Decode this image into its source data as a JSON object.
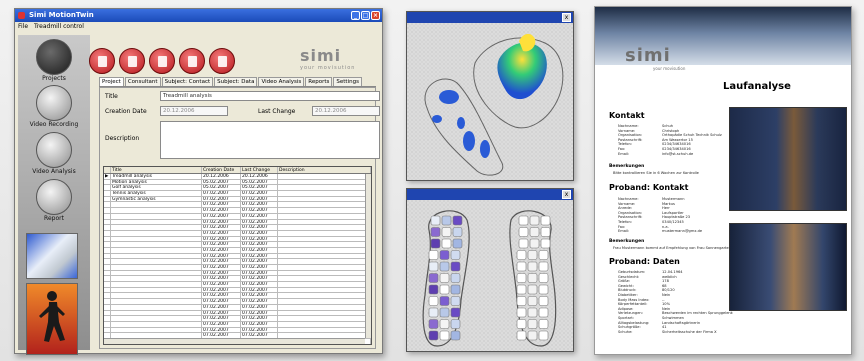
{
  "app": {
    "title": "Simi MotionTwin",
    "menu": [
      "File",
      "Treadmill control"
    ],
    "logo": {
      "text": "simi",
      "tagline": "your movisution"
    }
  },
  "sidebar": {
    "items": [
      {
        "label": "Projects",
        "icon": "folder-icon"
      },
      {
        "label": "Video Recording",
        "icon": "clapperboard-icon"
      },
      {
        "label": "Video Analysis",
        "icon": "analysis-icon"
      },
      {
        "label": "Report",
        "icon": "checkmark-icon"
      }
    ]
  },
  "toolbar": {
    "buttons": [
      "new-icon",
      "open-icon",
      "add-icon",
      "delete-icon",
      "search-icon"
    ]
  },
  "tabs": [
    "Project",
    "Consultant",
    "Subject: Contact",
    "Subject: Data",
    "Video Analysis",
    "Reports",
    "Settings"
  ],
  "form": {
    "title_label": "Title",
    "title_value": "Treadmill analysis",
    "creation_label": "Creation Date",
    "creation_value": "20.12.2006",
    "change_label": "Last Change",
    "change_value": "20.12.2006",
    "description_label": "Description"
  },
  "table": {
    "columns": [
      "Title",
      "Creation Date",
      "Last Change",
      "Description"
    ],
    "rows": [
      [
        "Treadmill analysis",
        "20.12.2006",
        "20.12.2006"
      ],
      [
        "Motion analysis",
        "05.02.2007",
        "05.02.2007"
      ],
      [
        "Golf analysis",
        "05.02.2007",
        "05.02.2007"
      ],
      [
        "Tennis analysis",
        "07.02.2007",
        "07.02.2007"
      ],
      [
        "Gymnastic analysis",
        "07.02.2007",
        "07.02.2007"
      ],
      [
        "",
        "07.02.2007",
        "07.02.2007"
      ],
      [
        "",
        "07.02.2007",
        "07.02.2007"
      ],
      [
        "",
        "07.02.2007",
        "07.02.2007"
      ],
      [
        "",
        "07.02.2007",
        "07.02.2007"
      ],
      [
        "",
        "07.02.2007",
        "07.02.2007"
      ],
      [
        "",
        "07.02.2007",
        "07.02.2007"
      ],
      [
        "",
        "07.02.2007",
        "07.02.2007"
      ],
      [
        "",
        "07.02.2007",
        "07.02.2007"
      ],
      [
        "",
        "07.02.2007",
        "07.02.2007"
      ],
      [
        "",
        "07.02.2007",
        "07.02.2007"
      ],
      [
        "",
        "07.02.2007",
        "07.02.2007"
      ],
      [
        "",
        "07.02.2007",
        "07.02.2007"
      ],
      [
        "",
        "07.02.2007",
        "07.02.2007"
      ],
      [
        "",
        "07.02.2007",
        "07.02.2007"
      ],
      [
        "",
        "07.02.2007",
        "07.02.2007"
      ],
      [
        "",
        "07.02.2007",
        "07.02.2007"
      ],
      [
        "",
        "07.02.2007",
        "07.02.2007"
      ],
      [
        "",
        "07.02.2007",
        "07.02.2007"
      ],
      [
        "",
        "07.02.2007",
        "07.02.2007"
      ],
      [
        "",
        "07.02.2007",
        "07.02.2007"
      ],
      [
        "",
        "07.02.2007",
        "07.02.2007"
      ],
      [
        "",
        "07.02.2007",
        "07.02.2007"
      ],
      [
        "",
        "07.02.2007",
        "07.02.2007"
      ],
      [
        "",
        "07.02.2007",
        "07.02.2007"
      ],
      [
        "",
        "07.02.2007",
        "07.02.2007"
      ],
      [
        "",
        "07.02.2007",
        "07.02.2007"
      ],
      [
        "",
        "07.02.2007",
        "07.02.2007"
      ],
      [
        "",
        "07.02.2007",
        "07.02.2007"
      ]
    ]
  },
  "pressure_window_3d": {
    "close": "x"
  },
  "pressure_window_2d": {
    "close": "x"
  },
  "report": {
    "logo": "simi",
    "tagline": "your movisution",
    "title": "Laufanalyse",
    "sec1": "Kontakt",
    "contact": [
      [
        "Nachname:",
        "Schuh"
      ],
      [
        "Vorname:",
        "Christoph"
      ],
      [
        "Organisation:",
        "Orthopädie Schuh Technik Schulz"
      ],
      [
        "Postanschrift:",
        "Am Wassertor 15"
      ],
      [
        "Telefon:",
        "0234/34634016"
      ],
      [
        "Fax:",
        "0234/34634016"
      ],
      [
        "Email:",
        "info@st-schuh.de"
      ]
    ],
    "remarks_label": "Bemerkungen",
    "remarks1": "Bitte kontrollieren Sie in 6 Wochen zur Kontrolle",
    "sec2": "Proband: Kontakt",
    "subject": [
      [
        "Nachname:",
        "Mustermann"
      ],
      [
        "Vorname:",
        "Markus"
      ],
      [
        "Anrede:",
        "Herr"
      ],
      [
        "Organisation:",
        "Laufsportler"
      ],
      [
        "Postanschrift:",
        "Hauptstraße 23"
      ],
      [
        "Telefon:",
        "0340/12345"
      ],
      [
        "Fax:",
        "n.a."
      ],
      [
        "Email:",
        "mustermann@gmx.de"
      ]
    ],
    "remarks2": "Frau Mustermann kommt auf Empfehlung von Frau Sonnengarten",
    "sec3": "Proband: Daten",
    "data": [
      [
        "Geburtsdatum:",
        "12.04.1964"
      ],
      [
        "Geschlecht:",
        "weiblich"
      ],
      [
        "Größe:",
        "178"
      ],
      [
        "Gewicht:",
        "68"
      ],
      [
        "Blutdruck:",
        "80/120"
      ],
      [
        "Diabetiker:",
        "Nein"
      ],
      [
        "Body Mass Index:",
        "--"
      ],
      [
        "Körperfettanteil:",
        "10%"
      ],
      [
        "Adipose:",
        "Nein"
      ],
      [
        "Verletzungen:",
        "Beschwerden im rechten Sprunggelenk"
      ],
      [
        "Sportart:",
        "Schwimmen"
      ],
      [
        "Alltagsbelastung:",
        "Landschaftsgärtnerin"
      ],
      [
        "Schuhgröße:",
        "41"
      ],
      [
        "Schuhe:",
        "Sicherheitsschuhe der Firma X"
      ]
    ]
  }
}
